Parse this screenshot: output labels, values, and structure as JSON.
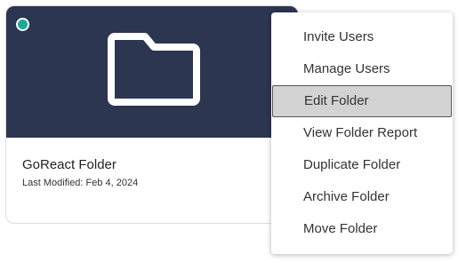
{
  "card": {
    "title": "GoReact Folder",
    "last_modified": "Last Modified: Feb 4, 2024",
    "status_color": "#1aa89b",
    "header_color": "#2c3650"
  },
  "menu": {
    "items": [
      {
        "label": "Invite Users"
      },
      {
        "label": "Manage Users"
      },
      {
        "label": "Edit Folder",
        "active": true
      },
      {
        "label": "View Folder Report"
      },
      {
        "label": "Duplicate Folder"
      },
      {
        "label": "Archive Folder"
      },
      {
        "label": "Move Folder"
      }
    ]
  }
}
